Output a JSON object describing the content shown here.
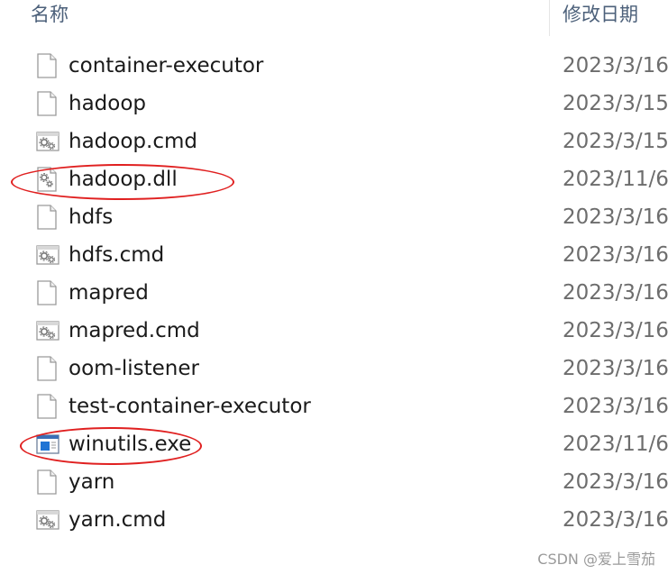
{
  "header": {
    "name_column": "名称",
    "date_column": "修改日期"
  },
  "files": [
    {
      "name": "container-executor",
      "date": "2023/3/16",
      "icon": "blank-file-icon"
    },
    {
      "name": "hadoop",
      "date": "2023/3/15",
      "icon": "blank-file-icon"
    },
    {
      "name": "hadoop.cmd",
      "date": "2023/3/15",
      "icon": "gear-file-icon"
    },
    {
      "name": "hadoop.dll",
      "date": "2023/11/6",
      "icon": "gear-file-icon"
    },
    {
      "name": "hdfs",
      "date": "2023/3/16",
      "icon": "blank-file-icon"
    },
    {
      "name": "hdfs.cmd",
      "date": "2023/3/16",
      "icon": "gear-file-icon"
    },
    {
      "name": "mapred",
      "date": "2023/3/16",
      "icon": "blank-file-icon"
    },
    {
      "name": "mapred.cmd",
      "date": "2023/3/16",
      "icon": "gear-file-icon"
    },
    {
      "name": "oom-listener",
      "date": "2023/3/16",
      "icon": "blank-file-icon"
    },
    {
      "name": "test-container-executor",
      "date": "2023/3/16",
      "icon": "blank-file-icon"
    },
    {
      "name": "winutils.exe",
      "date": "2023/11/6",
      "icon": "exe-window-icon"
    },
    {
      "name": "yarn",
      "date": "2023/3/16",
      "icon": "blank-file-icon"
    },
    {
      "name": "yarn.cmd",
      "date": "2023/3/16",
      "icon": "gear-file-icon"
    }
  ],
  "annotation_color": "#e02020",
  "watermark": "CSDN @爱上雪茄"
}
